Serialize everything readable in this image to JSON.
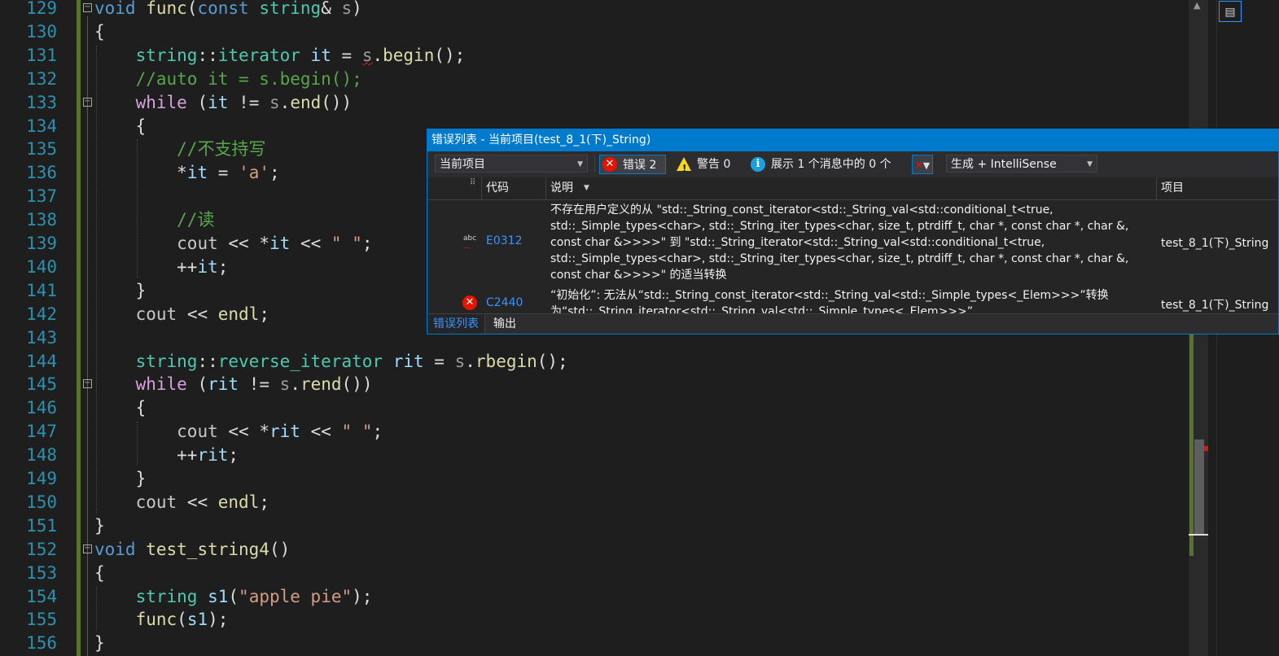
{
  "editor": {
    "lines": [
      {
        "n": "129",
        "fold": "minus",
        "html": "<span class='k'>void</span> <span class='f'>func</span><span class='p'>(</span><span class='k'>const</span> <span class='ty'>string</span><span class='p'>&amp;</span> <span class='pm'>s</span><span class='p'>)</span>"
      },
      {
        "n": "130",
        "html": "<span class='p'>{</span>"
      },
      {
        "n": "131",
        "html": "    <span class='ty'>string</span><span class='p'>::</span><span class='ty'>iterator</span> <span class='v'>it</span> <span class='p'>=</span> <span class='pm squig'>s</span><span class='p'>.</span><span class='f'>begin</span><span class='p'>();</span>"
      },
      {
        "n": "132",
        "html": "    <span class='c'>//auto it = s.begin();</span>"
      },
      {
        "n": "133",
        "fold": "minus",
        "html": "    <span class='kw'>while</span> <span class='p'>(</span><span class='v'>it</span> <span class='p'>!=</span> <span class='pm'>s</span><span class='p'>.</span><span class='f'>end</span><span class='p'>())</span>"
      },
      {
        "n": "134",
        "html": "    <span class='p'>{</span>"
      },
      {
        "n": "135",
        "html": "        <span class='c'>//不支持写</span>"
      },
      {
        "n": "136",
        "html": "        <span class='p'>*</span><span class='v'>it</span> <span class='p'>=</span> <span class='s'>'a'</span><span class='p'>;</span>"
      },
      {
        "n": "137",
        "html": ""
      },
      {
        "n": "138",
        "html": "        <span class='c'>//读</span>"
      },
      {
        "n": "139",
        "html": "        <span class='vk'>cout</span> <span class='p'>&lt;&lt;</span> <span class='p'>*</span><span class='v'>it</span> <span class='p'>&lt;&lt;</span> <span class='s'>\" \"</span><span class='p'>;</span>"
      },
      {
        "n": "140",
        "html": "        <span class='p'>++</span><span class='v'>it</span><span class='p'>;</span>"
      },
      {
        "n": "141",
        "html": "    <span class='p'>}</span>"
      },
      {
        "n": "142",
        "html": "    <span class='vk'>cout</span> <span class='p'>&lt;&lt;</span> <span class='f'>endl</span><span class='p'>;</span>"
      },
      {
        "n": "143",
        "html": ""
      },
      {
        "n": "144",
        "html": "    <span class='ty'>string</span><span class='p'>::</span><span class='ty'>reverse_iterator</span> <span class='v'>rit</span> <span class='p'>=</span> <span class='pm'>s</span><span class='p'>.</span><span class='f'>rbegin</span><span class='p'>();</span>"
      },
      {
        "n": "145",
        "fold": "minus",
        "html": "    <span class='kw'>while</span> <span class='p'>(</span><span class='v'>rit</span> <span class='p'>!=</span> <span class='pm'>s</span><span class='p'>.</span><span class='f'>rend</span><span class='p'>())</span>"
      },
      {
        "n": "146",
        "html": "    <span class='p'>{</span>"
      },
      {
        "n": "147",
        "html": "        <span class='vk'>cout</span> <span class='p'>&lt;&lt;</span> <span class='p'>*</span><span class='v'>rit</span> <span class='p'>&lt;&lt;</span> <span class='s'>\" \"</span><span class='p'>;</span>"
      },
      {
        "n": "148",
        "html": "        <span class='p'>++</span><span class='v'>rit</span><span class='p'>;</span>"
      },
      {
        "n": "149",
        "html": "    <span class='p'>}</span>"
      },
      {
        "n": "150",
        "html": "    <span class='vk'>cout</span> <span class='p'>&lt;&lt;</span> <span class='f'>endl</span><span class='p'>;</span>"
      },
      {
        "n": "151",
        "html": "<span class='p'>}</span>"
      },
      {
        "n": "152",
        "fold": "minus",
        "html": "<span class='k'>void</span> <span class='f'>test_string4</span><span class='p'>()</span>"
      },
      {
        "n": "153",
        "html": "<span class='p'>{</span>"
      },
      {
        "n": "154",
        "html": "    <span class='ty'>string</span> <span class='v'>s1</span><span class='p'>(</span><span class='s'>\"apple pie\"</span><span class='p'>);</span>"
      },
      {
        "n": "155",
        "html": "    <span class='f'>func</span><span class='p'>(</span><span class='v'>s1</span><span class='p'>);</span>"
      },
      {
        "n": "156",
        "html": "<span class='p'>}</span>"
      }
    ]
  },
  "error_list": {
    "title": "错误列表 - 当前项目(test_8_1(下)_String)",
    "scope": "当前项目",
    "errors_label": "错误 2",
    "warnings_label": "警告 0",
    "messages_label": "展示 1 个消息中的 0 个",
    "build_filter": "生成 + IntelliSense",
    "columns": {
      "code": "代码",
      "description": "说明",
      "project": "项目"
    },
    "rows": [
      {
        "icon": "intellisense-squiggle-icon",
        "code": "E0312",
        "description_lines": [
          "不存在用户定义的从 \"std::_String_const_iterator<std::_String_val<std::conditional_t<true,",
          "std::_Simple_types<char>, std::_String_iter_types<char, size_t, ptrdiff_t, char *, const char *, char &,",
          "const char &>>>>\" 到 \"std::_String_iterator<std::_String_val<std::conditional_t<true,",
          "std::_Simple_types<char>, std::_String_iter_types<char, size_t, ptrdiff_t, char *, const char *, char &,",
          "const char &>>>>\" 的适当转换"
        ],
        "project": "test_8_1(下)_String"
      },
      {
        "icon": "error-icon",
        "code": "C2440",
        "description_lines": [
          "“初始化”: 无法从“std::_String_const_iterator<std::_String_val<std::_Simple_types<_Elem>>>”转换",
          "为“std::_String_iterator<std::_String_val<std::_Simple_types<_Elem>>>”"
        ],
        "project": "test_8_1(下)_String"
      }
    ],
    "tabs": [
      "错误列表",
      "输出"
    ]
  },
  "colors": {
    "accent": "#007acc",
    "error": "#e51400",
    "warning": "#f8d81c",
    "info": "#1ba1e2"
  }
}
